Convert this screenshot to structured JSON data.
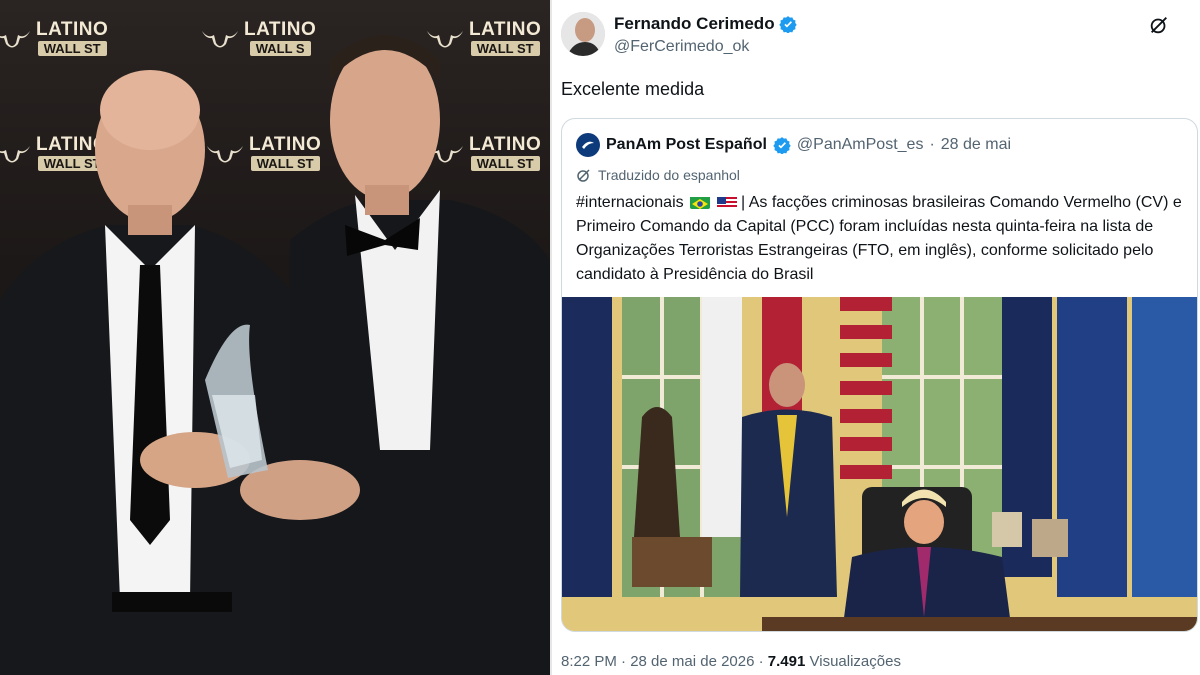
{
  "photo_left": {
    "brand_line1": "LATINO",
    "brand_line2": "WALL ST",
    "brand_line2_clipped": "WALL S"
  },
  "tweet": {
    "author_name": "Fernando Cerimedo",
    "author_handle": "@FerCerimedo_ok",
    "text": "Excelente medida",
    "timestamp": "8:22 PM · 28 de mai de 2026 · ",
    "views_count": "7.491",
    "views_label": " Visualizações",
    "icons": [
      "verified-badge-icon",
      "grok-icon"
    ]
  },
  "quoted_tweet": {
    "author_name": "PanAm Post Español",
    "author_handle": "@PanAmPost_es",
    "separator": "·",
    "date": "28 de mai",
    "translated_label": "Traduzido do espanhol",
    "hashtag": "#internacionais",
    "body": " | As facções criminosas brasileiras Comando Vermelho (CV) e Primeiro Comando da Capital (PCC) foram incluídas nesta quinta-feira na lista de Organizações Terroristas Estrangeiras (FTO, em inglês), conforme solicitado pelo candidato à Presidência do Brasil",
    "flags": [
      "brazil-flag-icon",
      "usa-flag-icon"
    ]
  },
  "colors": {
    "verified_blue": "#1d9bf0",
    "text_primary": "#0f1419",
    "text_secondary": "#536471",
    "border": "#cfd9de"
  }
}
